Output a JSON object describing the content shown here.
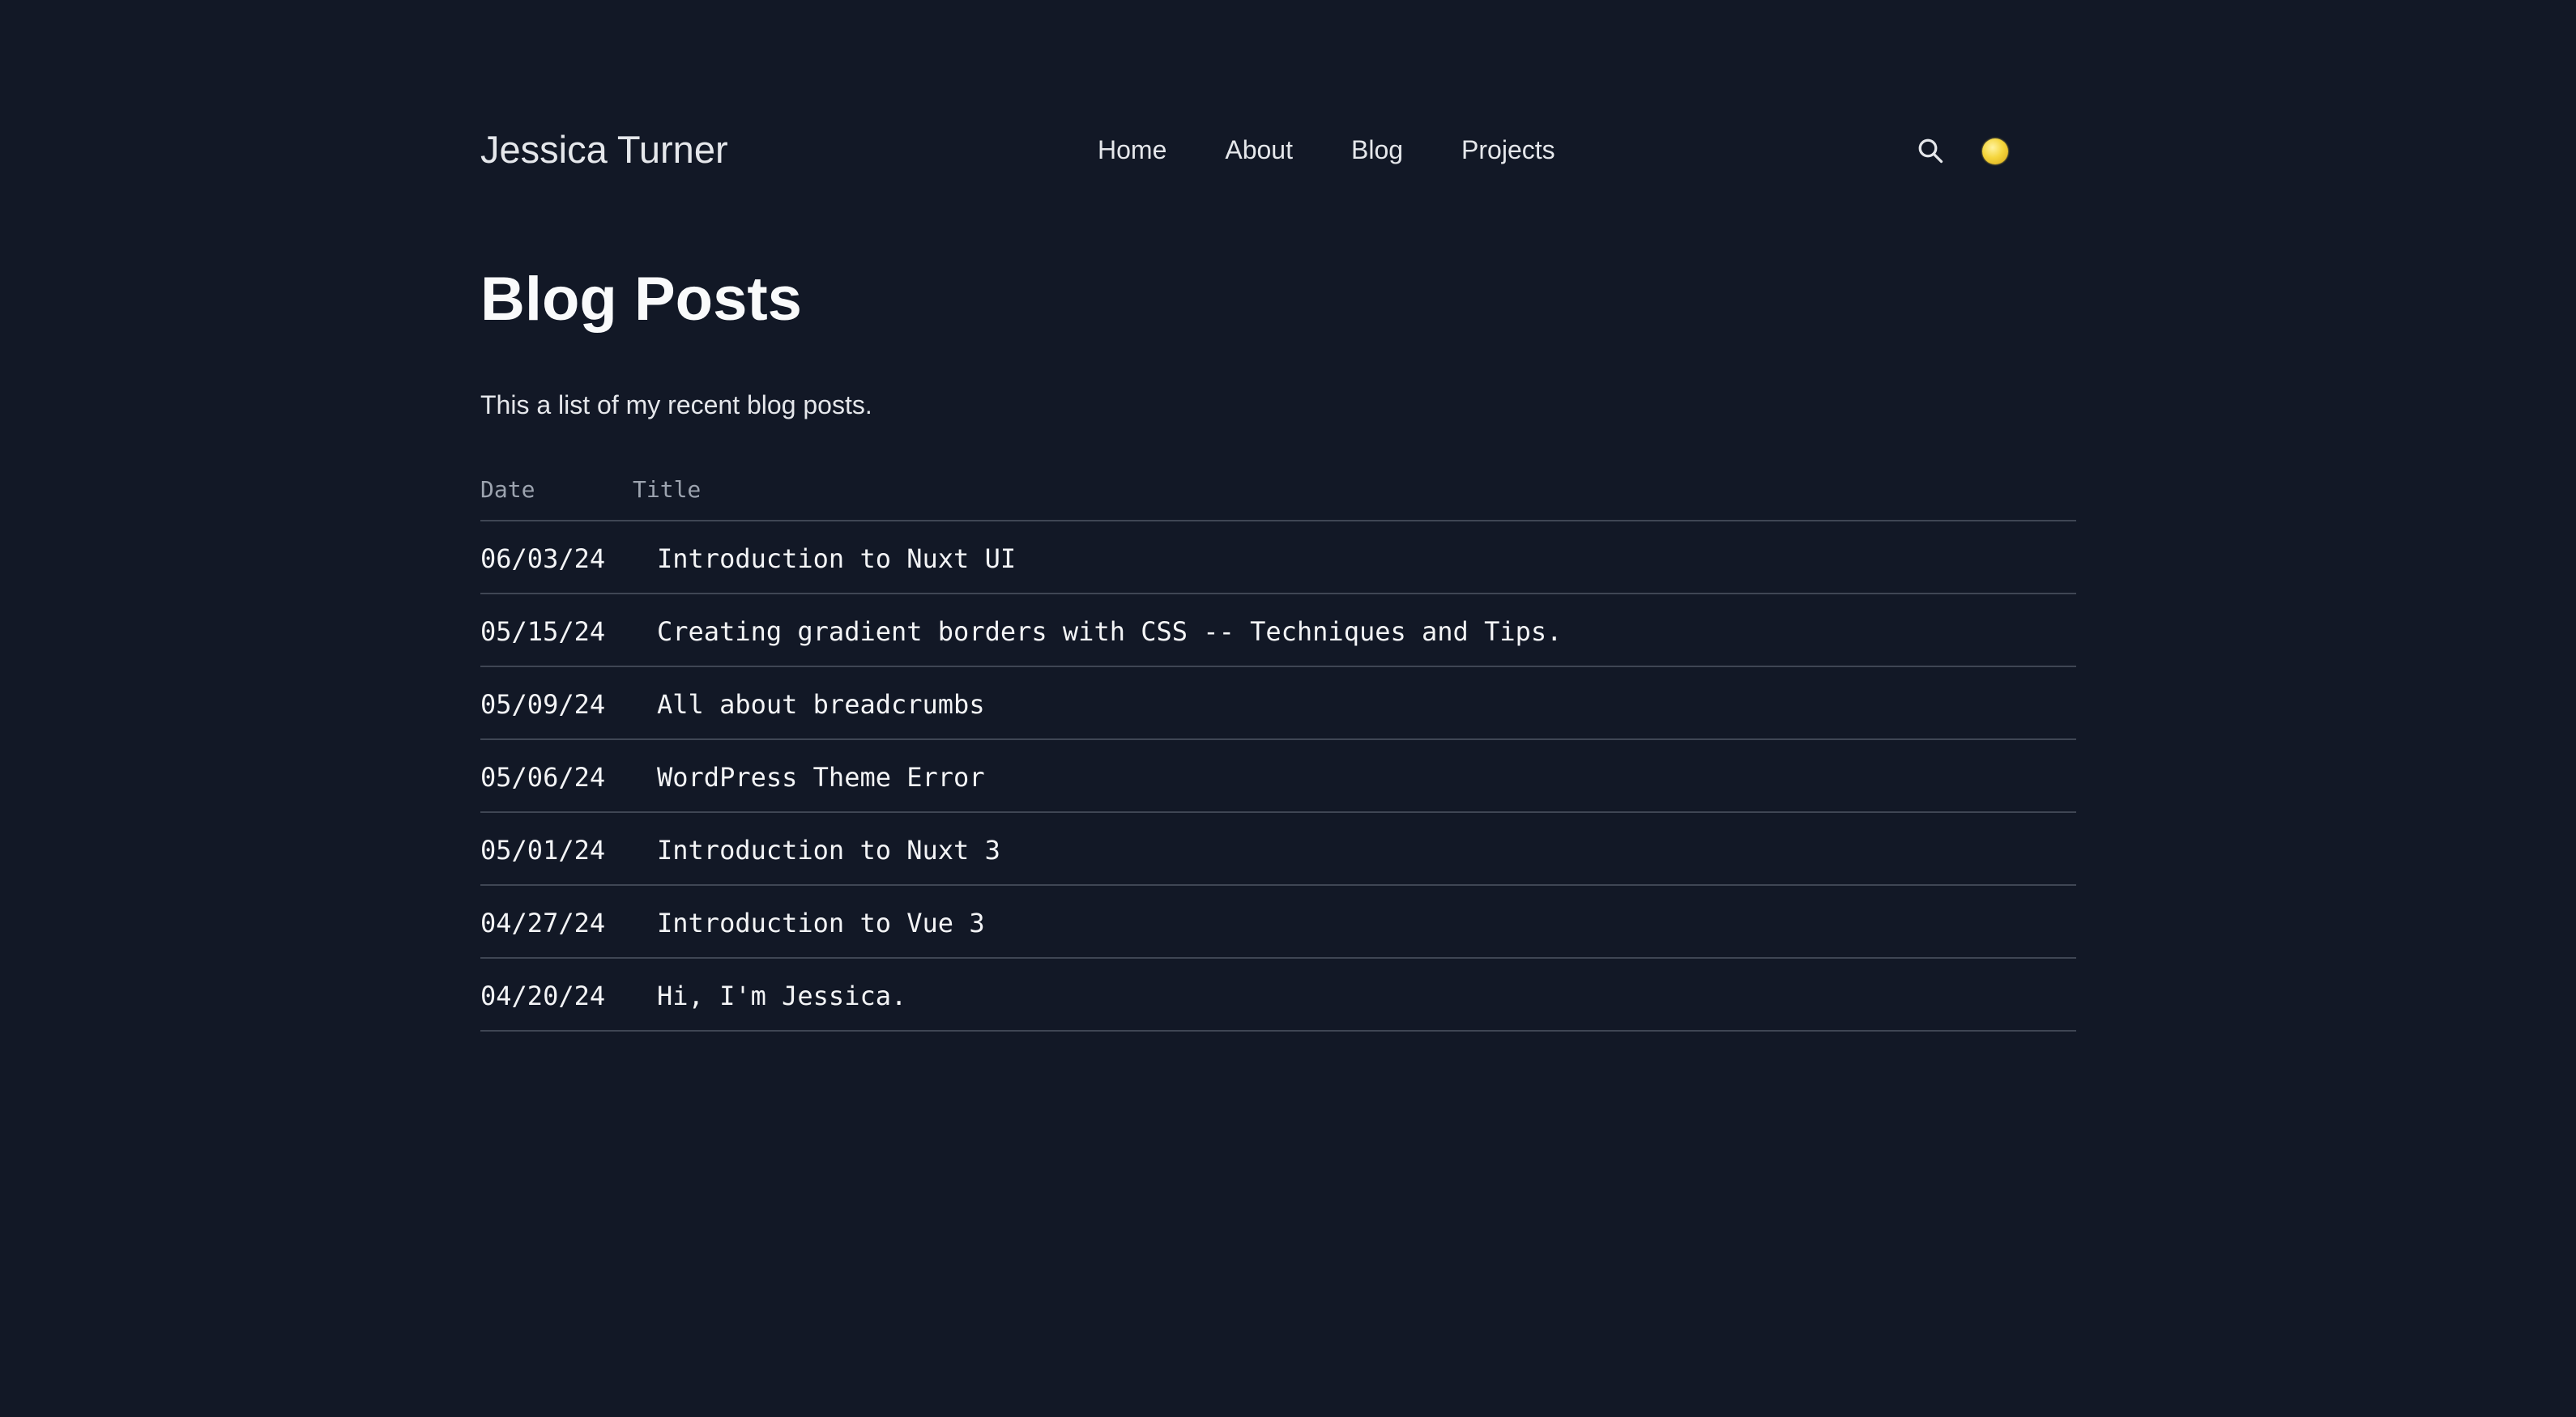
{
  "header": {
    "site_name": "Jessica Turner",
    "nav": [
      {
        "label": "Home"
      },
      {
        "label": "About"
      },
      {
        "label": "Blog"
      },
      {
        "label": "Projects"
      }
    ],
    "icons": {
      "search": "search-icon",
      "theme_toggle": "sun-icon"
    }
  },
  "main": {
    "title": "Blog Posts",
    "intro": "This a list of my recent blog posts.",
    "table": {
      "headers": {
        "date": "Date",
        "title": "Title"
      },
      "rows": [
        {
          "date": "06/03/24",
          "title": "Introduction to Nuxt UI"
        },
        {
          "date": "05/15/24",
          "title": "Creating gradient borders with CSS -- Techniques and Tips."
        },
        {
          "date": "05/09/24",
          "title": "All about breadcrumbs"
        },
        {
          "date": "05/06/24",
          "title": "WordPress Theme Error"
        },
        {
          "date": "05/01/24",
          "title": "Introduction to Nuxt 3"
        },
        {
          "date": "04/27/24",
          "title": "Introduction to Vue 3"
        },
        {
          "date": "04/20/24",
          "title": "Hi, I'm Jessica."
        }
      ]
    }
  },
  "colors": {
    "background": "#121826",
    "text": "#e5e7eb",
    "muted": "#9ca3af",
    "divider": "#3f4654",
    "sun": "#f5d63d"
  }
}
